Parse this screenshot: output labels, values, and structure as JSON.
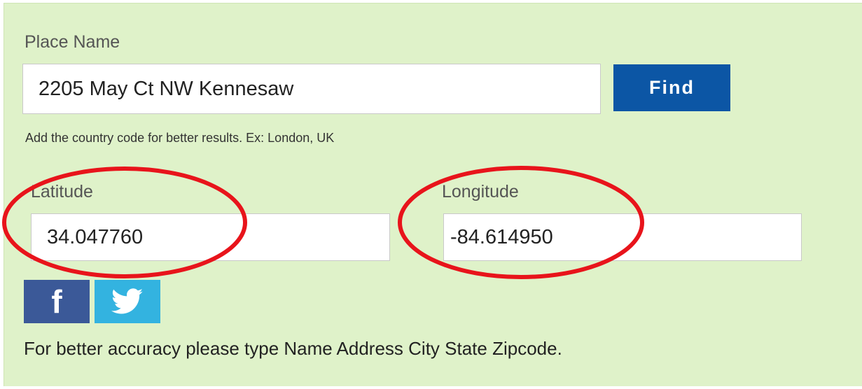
{
  "form": {
    "place_label": "Place Name",
    "place_value": "2205 May Ct NW Kennesaw",
    "find_label": "Find",
    "hint": "Add the country code for better results. Ex: London, UK",
    "latitude_label": "Latitude",
    "latitude_value": "34.047760",
    "longitude_label": "Longitude",
    "longitude_value": "-84.614950",
    "footer_note": "For better accuracy please type Name Address City State Zipcode."
  },
  "social": {
    "facebook_glyph": "f",
    "facebook_icon": "facebook-icon",
    "twitter_icon": "twitter-icon"
  },
  "colors": {
    "panel_background": "#dff2c9",
    "find_button": "#0c56a5",
    "facebook": "#3b5998",
    "twitter": "#33b3e0",
    "annotation_circle": "#e8141b"
  }
}
